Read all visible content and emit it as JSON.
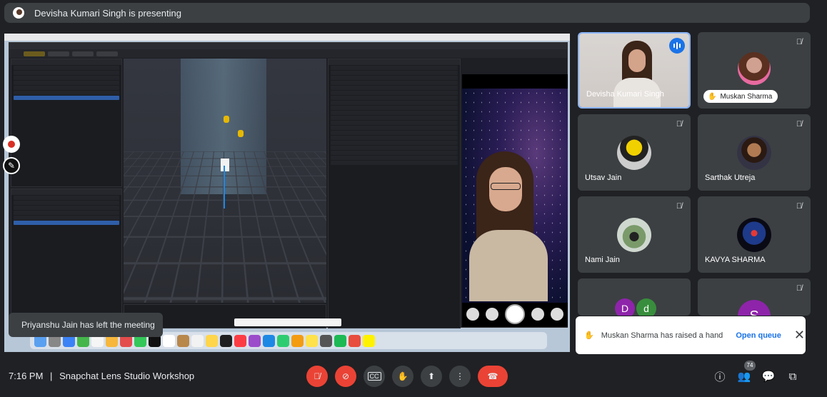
{
  "banner": {
    "text": "Devisha Kumari Singh is presenting"
  },
  "toast_left": {
    "text": "Priyanshu Jain has left the meeting"
  },
  "participants": [
    {
      "name": "Devisha Kumari Singh",
      "speaking": true
    },
    {
      "name": "Muskan Sharma",
      "hand_raised": true
    },
    {
      "name": "Utsav Jain"
    },
    {
      "name": "Sarthak Utreja"
    },
    {
      "name": "Nami Jain"
    },
    {
      "name": "KAVYA SHARMA"
    },
    {
      "initials": [
        "D",
        "d"
      ]
    },
    {
      "initial": "S"
    }
  ],
  "hand_toast": {
    "message": "Muskan Sharma has raised a hand",
    "action": "Open queue"
  },
  "bottombar": {
    "time": "7:16 PM",
    "separator": "|",
    "meeting_title": "Snapchat Lens Studio Workshop",
    "people_count": "74"
  },
  "colors": {
    "end_call": "#ea4335",
    "accent": "#1a73e8",
    "tile_bg": "#3c4043"
  }
}
